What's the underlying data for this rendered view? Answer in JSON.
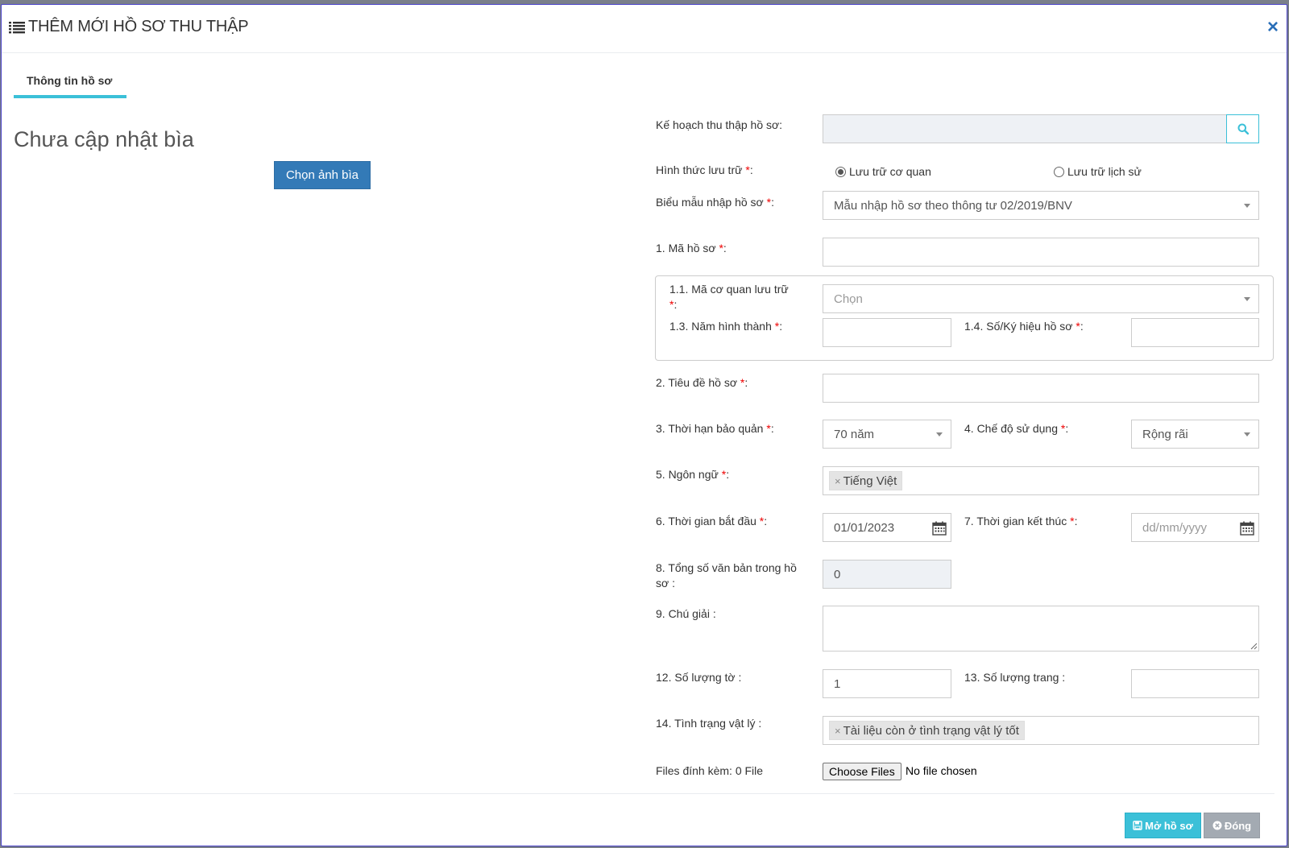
{
  "header": {
    "title": "THÊM MỚI HỒ SƠ THU THẬP",
    "close_symbol": "×"
  },
  "tabs": [
    {
      "label": "Thông tin hồ sơ",
      "active": true
    }
  ],
  "cover": {
    "title": "Chưa cập nhật bìa",
    "button_label": "Chọn ảnh bìa"
  },
  "form": {
    "plan": {
      "label": "Kế hoạch thu thập hồ sơ:",
      "value": ""
    },
    "storage_type": {
      "label": "Hình thức lưu trữ ",
      "options": [
        {
          "label": "Lưu trữ cơ quan",
          "selected": true
        },
        {
          "label": "Lưu trữ lịch sử",
          "selected": false
        }
      ]
    },
    "template": {
      "label": "Biểu mẫu nhập hồ sơ ",
      "value": "Mẫu nhập hồ sơ theo thông tư 02/2019/BNV"
    },
    "code": {
      "label": "1. Mã hồ sơ ",
      "value": ""
    },
    "agency_code": {
      "label": "1.1. Mã cơ quan lưu trữ",
      "placeholder": "Chọn"
    },
    "year": {
      "label": "1.3. Năm hình thành ",
      "value": ""
    },
    "symbol": {
      "label": "1.4. Số/Ký hiệu hồ sơ ",
      "value": ""
    },
    "title": {
      "label": "2. Tiêu đề hồ sơ ",
      "value": ""
    },
    "retention": {
      "label": "3. Thời hạn bảo quản ",
      "value": "70 năm"
    },
    "usage": {
      "label": "4. Chế độ sử dụng ",
      "value": "Rộng rãi"
    },
    "language": {
      "label": "5. Ngôn ngữ ",
      "tags": [
        "Tiếng Việt"
      ]
    },
    "start_date": {
      "label": "6. Thời gian bắt đầu ",
      "value": "01/01/2023"
    },
    "end_date": {
      "label": "7. Thời gian kết thúc ",
      "placeholder": "dd/mm/yyyy"
    },
    "doc_count": {
      "label_line1": "8. Tổng số văn bản trong hồ",
      "label_line2": "sơ :",
      "value": "0"
    },
    "notes": {
      "label": "9. Chú giải :",
      "value": ""
    },
    "sheets": {
      "label": "12. Số lượng tờ :",
      "value": "1"
    },
    "pages": {
      "label": "13. Số lượng trang :",
      "value": ""
    },
    "condition": {
      "label": "14. Tình trạng vật lý :",
      "tags": [
        "Tài liệu còn ở tình trạng vật lý tốt"
      ]
    },
    "files": {
      "label": "Files đính kèm: 0 File",
      "button_label": "Choose Files",
      "status": "No file chosen"
    },
    "required_mark": "*",
    "colon": ":"
  },
  "footer": {
    "save_label": "Mở hồ sơ",
    "close_label": "Đóng"
  },
  "colors": {
    "accent": "#3bc0d8",
    "primary": "#337ab7",
    "required": "#ee0000",
    "close_icon": "#2a6eb8"
  }
}
